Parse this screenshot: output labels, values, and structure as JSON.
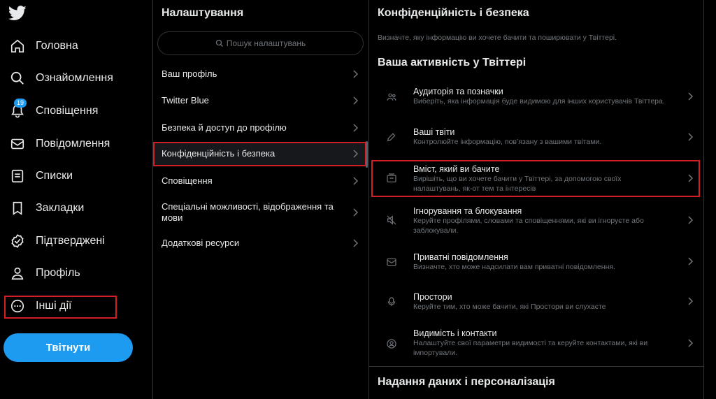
{
  "nav": {
    "items": [
      {
        "label": "Головна",
        "icon": "home-icon"
      },
      {
        "label": "Ознайомлення",
        "icon": "search-icon"
      },
      {
        "label": "Сповіщення",
        "icon": "bell-icon",
        "badge": "19"
      },
      {
        "label": "Повідомлення",
        "icon": "mail-icon"
      },
      {
        "label": "Списки",
        "icon": "list-icon"
      },
      {
        "label": "Закладки",
        "icon": "bookmark-icon"
      },
      {
        "label": "Підтверджені",
        "icon": "verified-icon"
      },
      {
        "label": "Профіль",
        "icon": "person-icon"
      },
      {
        "label": "Інші дії",
        "icon": "more-circle-icon"
      }
    ],
    "tweet_button": "Твітнути"
  },
  "settings": {
    "title": "Налаштування",
    "search_placeholder": "Пошук налаштувань",
    "items": [
      {
        "label": "Ваш профіль"
      },
      {
        "label": "Twitter Blue"
      },
      {
        "label": "Безпека й доступ до профілю"
      },
      {
        "label": "Конфіденційність і безпека",
        "active": true
      },
      {
        "label": "Сповіщення"
      },
      {
        "label": "Спеціальні можливості, відображення та мови"
      },
      {
        "label": "Додаткові ресурси"
      }
    ]
  },
  "privacy": {
    "title": "Конфіденційність і безпека",
    "description": "Визначте, яку інформацію ви хочете бачити та поширювати у Твіттері.",
    "section1_title": "Ваша активність у Твіттері",
    "items": [
      {
        "title": "Аудиторія та позначки",
        "desc": "Виберіть, яка інформація буде видимою для інших користувачів Твіттера.",
        "icon": "people-icon"
      },
      {
        "title": "Ваші твіти",
        "desc": "Контролюйте інформацію, пов’язану з вашими твітами.",
        "icon": "pencil-icon"
      },
      {
        "title": "Вміст, який ви бачите",
        "desc": "Вирішіть, що ви хочете бачити у Твіттері, за допомогою своїх налаштувань, як-от тем та інтересів",
        "icon": "content-icon"
      },
      {
        "title": "Ігнорування та блокування",
        "desc": "Керуйте профілями, словами та сповіщеннями, які ви ігноруєте або заблокували.",
        "icon": "mute-icon"
      },
      {
        "title": "Приватні повідомлення",
        "desc": "Визначте, хто може надсилати вам приватні повідомлення.",
        "icon": "mail-icon"
      },
      {
        "title": "Простори",
        "desc": "Керуйте тим, хто може бачити, які Простори ви слухаєте",
        "icon": "spaces-icon"
      },
      {
        "title": "Видимість і контакти",
        "desc": "Налаштуйте свої параметри видимості та керуйте контактами, які ви імпортували.",
        "icon": "contacts-icon"
      }
    ],
    "section2_title": "Надання даних і персоналізація"
  },
  "colors": {
    "accent": "#1d9bf0",
    "highlight": "#d21f26"
  }
}
